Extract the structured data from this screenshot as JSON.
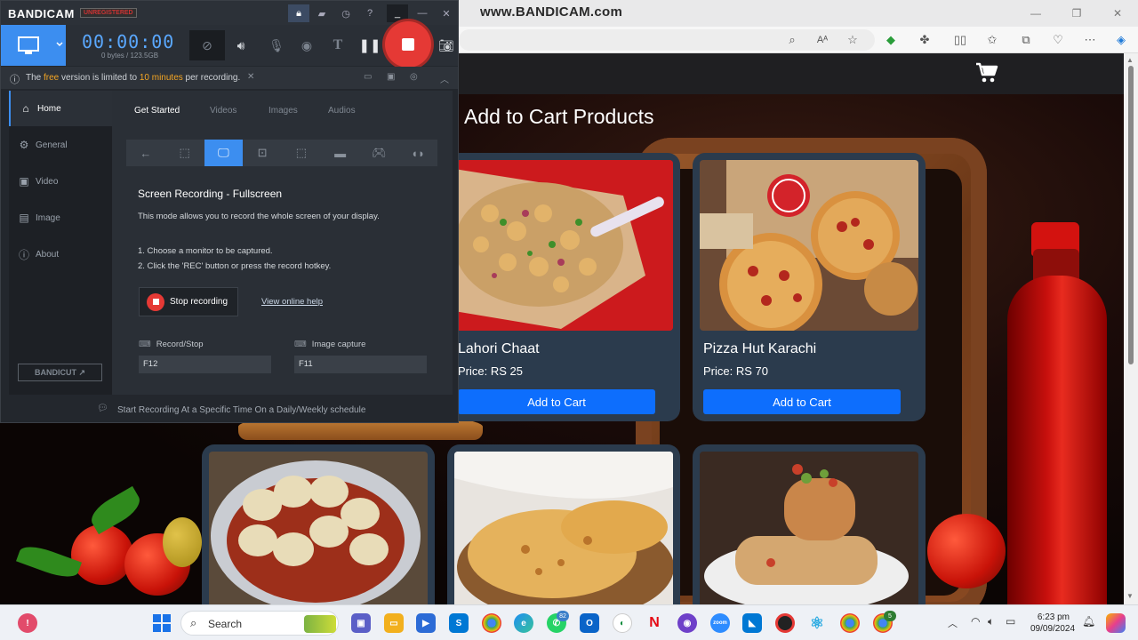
{
  "browser": {
    "watermark": "www.BANDICAM.com"
  },
  "site": {
    "page_title": "Add to Cart Products",
    "products": [
      {
        "name": "Lahori Chaat",
        "price": "Price: RS 25",
        "button": "Add to Cart"
      },
      {
        "name": "Pizza Hut Karachi",
        "price": "Price: RS 70",
        "button": "Add to Cart"
      }
    ]
  },
  "bandicam": {
    "logo": "BANDICAM",
    "unregistered": "UNREGISTERED",
    "timer": "00:00:00",
    "size": "0 bytes / 123.5GB",
    "notice": {
      "pre": "The ",
      "free": "free",
      "mid": " version is limited to ",
      "limit": "10 minutes",
      "post": " per recording."
    },
    "sidebar": [
      {
        "label": "Home",
        "icon": "home-icon"
      },
      {
        "label": "General",
        "icon": "gear-icon"
      },
      {
        "label": "Video",
        "icon": "video-icon"
      },
      {
        "label": "Image",
        "icon": "image-icon"
      },
      {
        "label": "About",
        "icon": "info-icon"
      }
    ],
    "bandicut": "BANDICUT ↗",
    "tabs": [
      "Get Started",
      "Videos",
      "Images",
      "Audios"
    ],
    "mode_title": "Screen Recording - Fullscreen",
    "description": "This mode allows you to record the whole screen of your display.",
    "steps": [
      "1. Choose a monitor to be captured.",
      "2. Click the 'REC' button or press the record hotkey."
    ],
    "stop_button": "Stop recording",
    "help_link": "View online help",
    "hotkeys": [
      {
        "label": "Record/Stop",
        "value": "F12"
      },
      {
        "label": "Image capture",
        "value": "F11"
      }
    ],
    "bottom_text": "Start Recording At a Specific Time On a Daily/Weekly schedule"
  },
  "taskbar": {
    "search_label": "Search",
    "whatsapp_badge": "82",
    "chrome_badge": "5",
    "time": "6:23 pm",
    "date": "09/09/2024"
  },
  "colors": {
    "bandicam_accent": "#3c8ef0",
    "rec_red": "#e53935",
    "cart_button": "#0d6efd",
    "card_bg": "#2b3b4d"
  }
}
